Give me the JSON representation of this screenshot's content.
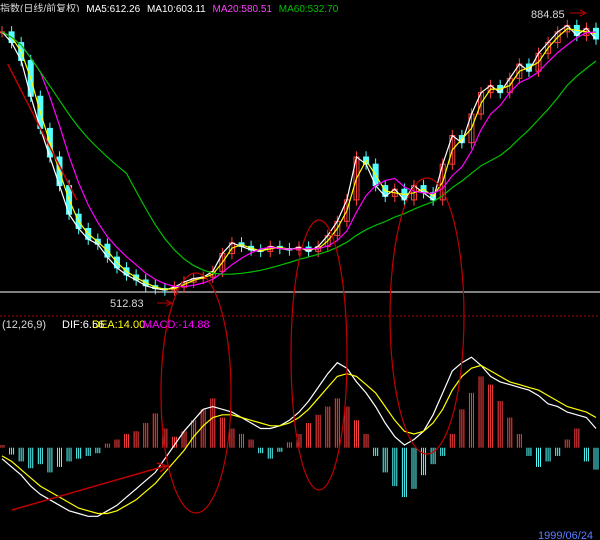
{
  "header": {
    "title": "指数(日线/前复权)",
    "ma1": "MA5:612.26",
    "ma2": "MA10:603.11",
    "ma3": "MA20:580.51",
    "ma4": "MA60:532.70"
  },
  "colors": {
    "background": "#000000",
    "bull": "#ff4040",
    "bear": "#54ffff",
    "ma5": "#ffffff",
    "ma10": "#ffff00",
    "ma20": "#ff00ff",
    "ma60": "#00c000",
    "support_line": "#ffffff",
    "dotted_line": "#b00000",
    "dif": "#ffffff",
    "dea": "#ffff00",
    "macd_label": "#ff00ff",
    "annotation": "#c00000"
  },
  "price_annotations": {
    "high": "884.85",
    "low": "512.83"
  },
  "macd_header": {
    "params": "(12,26,9)",
    "dif": "DIF:6.56",
    "dea": "DEA:14.00",
    "macd": "MACD:-14.88"
  },
  "footer_date": "1999/06/24",
  "chart_data": [
    {
      "type": "candlestick",
      "title": "",
      "x": [
        1,
        6,
        11,
        16,
        21,
        26,
        31,
        36,
        41,
        46,
        51,
        56,
        61,
        66,
        71,
        76,
        81,
        86,
        91,
        96,
        101
      ],
      "close": [
        875,
        860,
        835,
        785,
        740,
        700,
        660,
        620,
        600,
        585,
        578,
        560,
        545,
        535,
        528,
        520,
        516,
        514,
        518,
        525,
        530
      ],
      "x2": [
        106,
        111,
        116,
        121,
        126,
        131,
        136,
        141,
        146,
        151,
        156,
        161,
        166,
        171,
        176,
        181,
        186,
        191,
        196,
        201,
        206
      ],
      "close2": [
        532,
        540,
        565,
        580,
        575,
        570,
        568,
        575,
        572,
        570,
        574,
        568,
        575,
        590,
        610,
        640,
        700,
        690,
        660,
        645,
        655
      ],
      "x3": [
        211,
        216,
        221,
        226,
        231,
        236,
        241,
        246,
        251,
        256,
        261,
        266,
        271,
        276,
        281,
        286,
        291,
        296,
        301,
        306,
        311
      ],
      "close3": [
        640,
        660,
        650,
        640,
        690,
        730,
        720,
        760,
        790,
        800,
        790,
        810,
        830,
        820,
        845,
        860,
        875,
        884,
        870,
        880,
        865
      ],
      "ma_periods": [
        5,
        10,
        20,
        60
      ],
      "annotations": [
        "884.85",
        "512.83"
      ],
      "ylim": [
        500,
        900
      ]
    },
    {
      "type": "bar",
      "title": "MACD(12,26,9)",
      "series_names": [
        "DIF",
        "DEA",
        "MACD"
      ],
      "macd_x": [
        1,
        6,
        11,
        16,
        21,
        26,
        31,
        36,
        41,
        46,
        51,
        56,
        61,
        66,
        71,
        76,
        81,
        86,
        91,
        96,
        101,
        106,
        111,
        116,
        121,
        126,
        131,
        136,
        141,
        146,
        151,
        156,
        161,
        166,
        171,
        176,
        181,
        186,
        191,
        196,
        201,
        206,
        211,
        216,
        221,
        226,
        231,
        236,
        241,
        246,
        251,
        256,
        261,
        266,
        271,
        276,
        281,
        286,
        291,
        296,
        301,
        306,
        311
      ],
      "macd_values": [
        2,
        -5,
        -10,
        -15,
        -12,
        -18,
        -14,
        -10,
        -8,
        -6,
        -4,
        3,
        6,
        10,
        12,
        18,
        25,
        14,
        8,
        12,
        20,
        28,
        36,
        22,
        14,
        10,
        6,
        -4,
        -8,
        -3,
        4,
        10,
        18,
        24,
        30,
        36,
        30,
        20,
        10,
        -6,
        -18,
        -28,
        -36,
        -30,
        -20,
        -12,
        -6,
        10,
        28,
        40,
        52,
        46,
        34,
        22,
        10,
        -6,
        -14,
        -10,
        -6,
        6,
        14,
        -10,
        -16
      ],
      "dif_values": [
        -8,
        -14,
        -20,
        -28,
        -34,
        -38,
        -42,
        -46,
        -48,
        -50,
        -50,
        -46,
        -42,
        -36,
        -30,
        -24,
        -18,
        -8,
        2,
        12,
        20,
        28,
        30,
        28,
        26,
        22,
        18,
        14,
        14,
        16,
        20,
        26,
        34,
        44,
        54,
        62,
        58,
        48,
        40,
        30,
        18,
        8,
        2,
        6,
        12,
        24,
        40,
        56,
        62,
        66,
        60,
        52,
        48,
        46,
        44,
        42,
        38,
        32,
        30,
        26,
        24,
        22,
        14
      ],
      "dea_values": [
        -6,
        -10,
        -16,
        -22,
        -28,
        -32,
        -36,
        -40,
        -44,
        -46,
        -48,
        -48,
        -46,
        -42,
        -38,
        -32,
        -26,
        -18,
        -10,
        -2,
        8,
        16,
        22,
        24,
        24,
        22,
        20,
        18,
        16,
        16,
        18,
        22,
        28,
        36,
        44,
        52,
        54,
        52,
        46,
        40,
        30,
        20,
        12,
        10,
        12,
        18,
        28,
        42,
        52,
        58,
        60,
        56,
        52,
        48,
        46,
        44,
        42,
        38,
        34,
        30,
        28,
        26,
        22
      ],
      "ylim": [
        -60,
        80
      ]
    }
  ]
}
